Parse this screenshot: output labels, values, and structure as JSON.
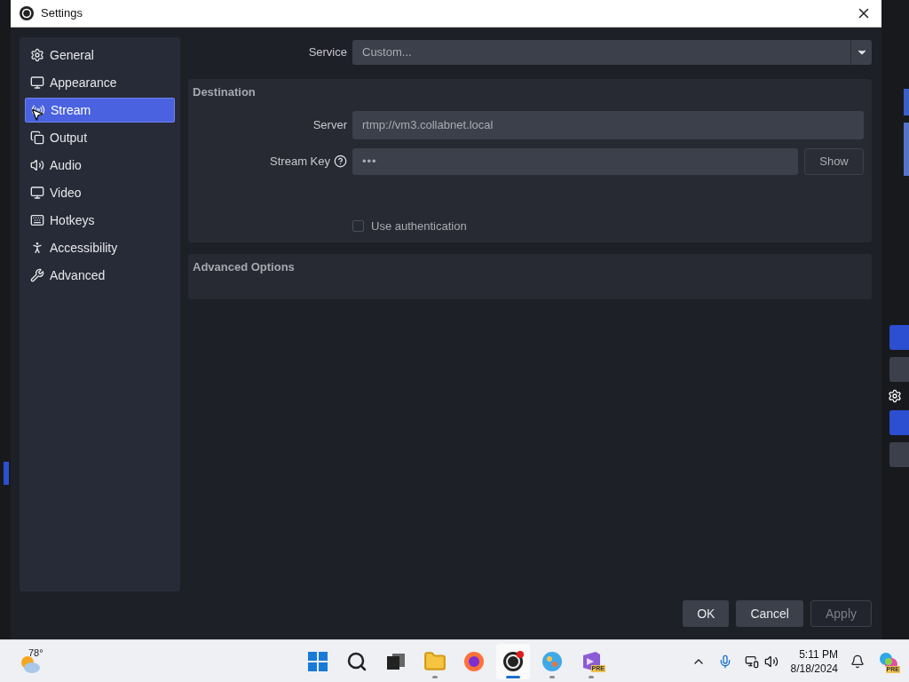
{
  "window": {
    "title": "Settings"
  },
  "sidebar": {
    "items": [
      {
        "label": "General",
        "selected": false
      },
      {
        "label": "Appearance",
        "selected": false
      },
      {
        "label": "Stream",
        "selected": true
      },
      {
        "label": "Output",
        "selected": false
      },
      {
        "label": "Audio",
        "selected": false
      },
      {
        "label": "Video",
        "selected": false
      },
      {
        "label": "Hotkeys",
        "selected": false
      },
      {
        "label": "Accessibility",
        "selected": false
      },
      {
        "label": "Advanced",
        "selected": false
      }
    ]
  },
  "service": {
    "label": "Service",
    "value": "Custom..."
  },
  "destination": {
    "title": "Destination",
    "server_label": "Server",
    "server": "rtmp://vm3.collabnet.local",
    "key_label": "Stream Key",
    "key": "•••",
    "show_button": "Show",
    "auth": {
      "label": "Use authentication",
      "checked": false
    }
  },
  "advanced_options": {
    "title": "Advanced Options"
  },
  "buttons": [
    {
      "label": "OK",
      "disabled": false
    },
    {
      "label": "Cancel",
      "disabled": false
    },
    {
      "label": "Apply",
      "disabled": true
    }
  ],
  "taskbar": {
    "temperature": "78°",
    "apps": [
      {
        "kind": "start",
        "running": false,
        "active": false
      },
      {
        "kind": "search",
        "running": false,
        "active": false
      },
      {
        "kind": "taskview",
        "running": false,
        "active": false
      },
      {
        "kind": "folder",
        "running": true,
        "active": false
      },
      {
        "kind": "firefox",
        "running": false,
        "active": false
      },
      {
        "kind": "obs",
        "running": true,
        "active": true
      },
      {
        "kind": "paint",
        "running": true,
        "active": false
      },
      {
        "kind": "studio",
        "running": true,
        "active": false,
        "badge": "PRE"
      }
    ],
    "time": "5:11 PM",
    "date": "8/18/2024",
    "copilot_badge": "PRE"
  }
}
